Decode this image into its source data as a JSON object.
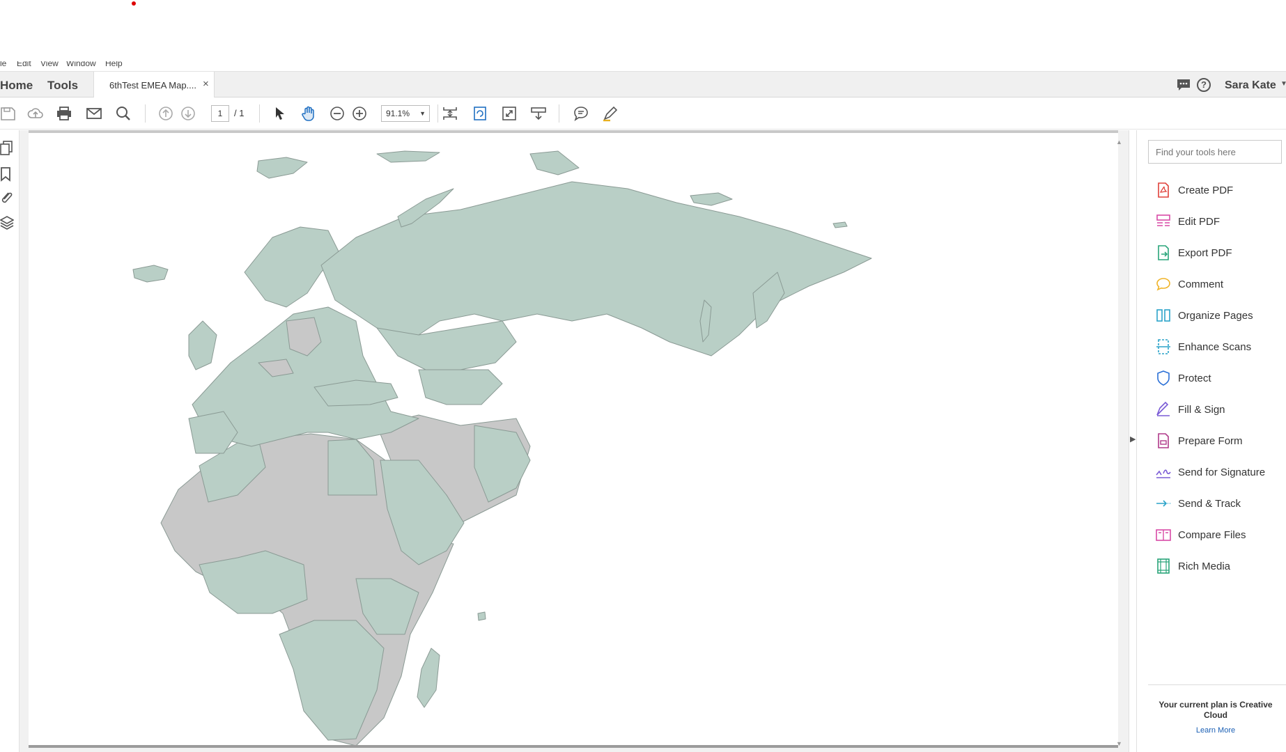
{
  "menu": [
    "le",
    "Edit",
    "View",
    "Window",
    "Help"
  ],
  "tabs": {
    "home": "Home",
    "tools": "Tools",
    "document": "6thTest EMEA Map....",
    "close": "×"
  },
  "user": {
    "name": "Sara Kate",
    "help": "?"
  },
  "toolbar": {
    "page_current": "1",
    "page_total": "/ 1",
    "zoom": "91.1%"
  },
  "tools_pane": {
    "search_placeholder": "Find your tools here",
    "items": [
      {
        "label": "Create PDF",
        "icon": "create-pdf-icon",
        "color": "#e0413a"
      },
      {
        "label": "Edit PDF",
        "icon": "edit-pdf-icon",
        "color": "#d84aa6"
      },
      {
        "label": "Export PDF",
        "icon": "export-pdf-icon",
        "color": "#2aa57a"
      },
      {
        "label": "Comment",
        "icon": "comment-icon",
        "color": "#f0b429"
      },
      {
        "label": "Organize Pages",
        "icon": "organize-pages-icon",
        "color": "#2ba3c9"
      },
      {
        "label": "Enhance Scans",
        "icon": "enhance-scans-icon",
        "color": "#2ba3c9"
      },
      {
        "label": "Protect",
        "icon": "protect-icon",
        "color": "#2a6fd6"
      },
      {
        "label": "Fill & Sign",
        "icon": "fill-sign-icon",
        "color": "#7a5bd6"
      },
      {
        "label": "Prepare Form",
        "icon": "prepare-form-icon",
        "color": "#b03a8a"
      },
      {
        "label": "Send for Signature",
        "icon": "send-signature-icon",
        "color": "#7a5bd6"
      },
      {
        "label": "Send & Track",
        "icon": "send-track-icon",
        "color": "#2ba3c9"
      },
      {
        "label": "Compare Files",
        "icon": "compare-files-icon",
        "color": "#d84aa6"
      },
      {
        "label": "Rich Media",
        "icon": "rich-media-icon",
        "color": "#2aa57a"
      }
    ],
    "plan_text": "Your current plan is Creative Cloud",
    "learn_more": "Learn More"
  },
  "map": {
    "highlight_color": "#b9cfc6",
    "base_color": "#c8c8c8",
    "border_color": "#8a9a94"
  }
}
